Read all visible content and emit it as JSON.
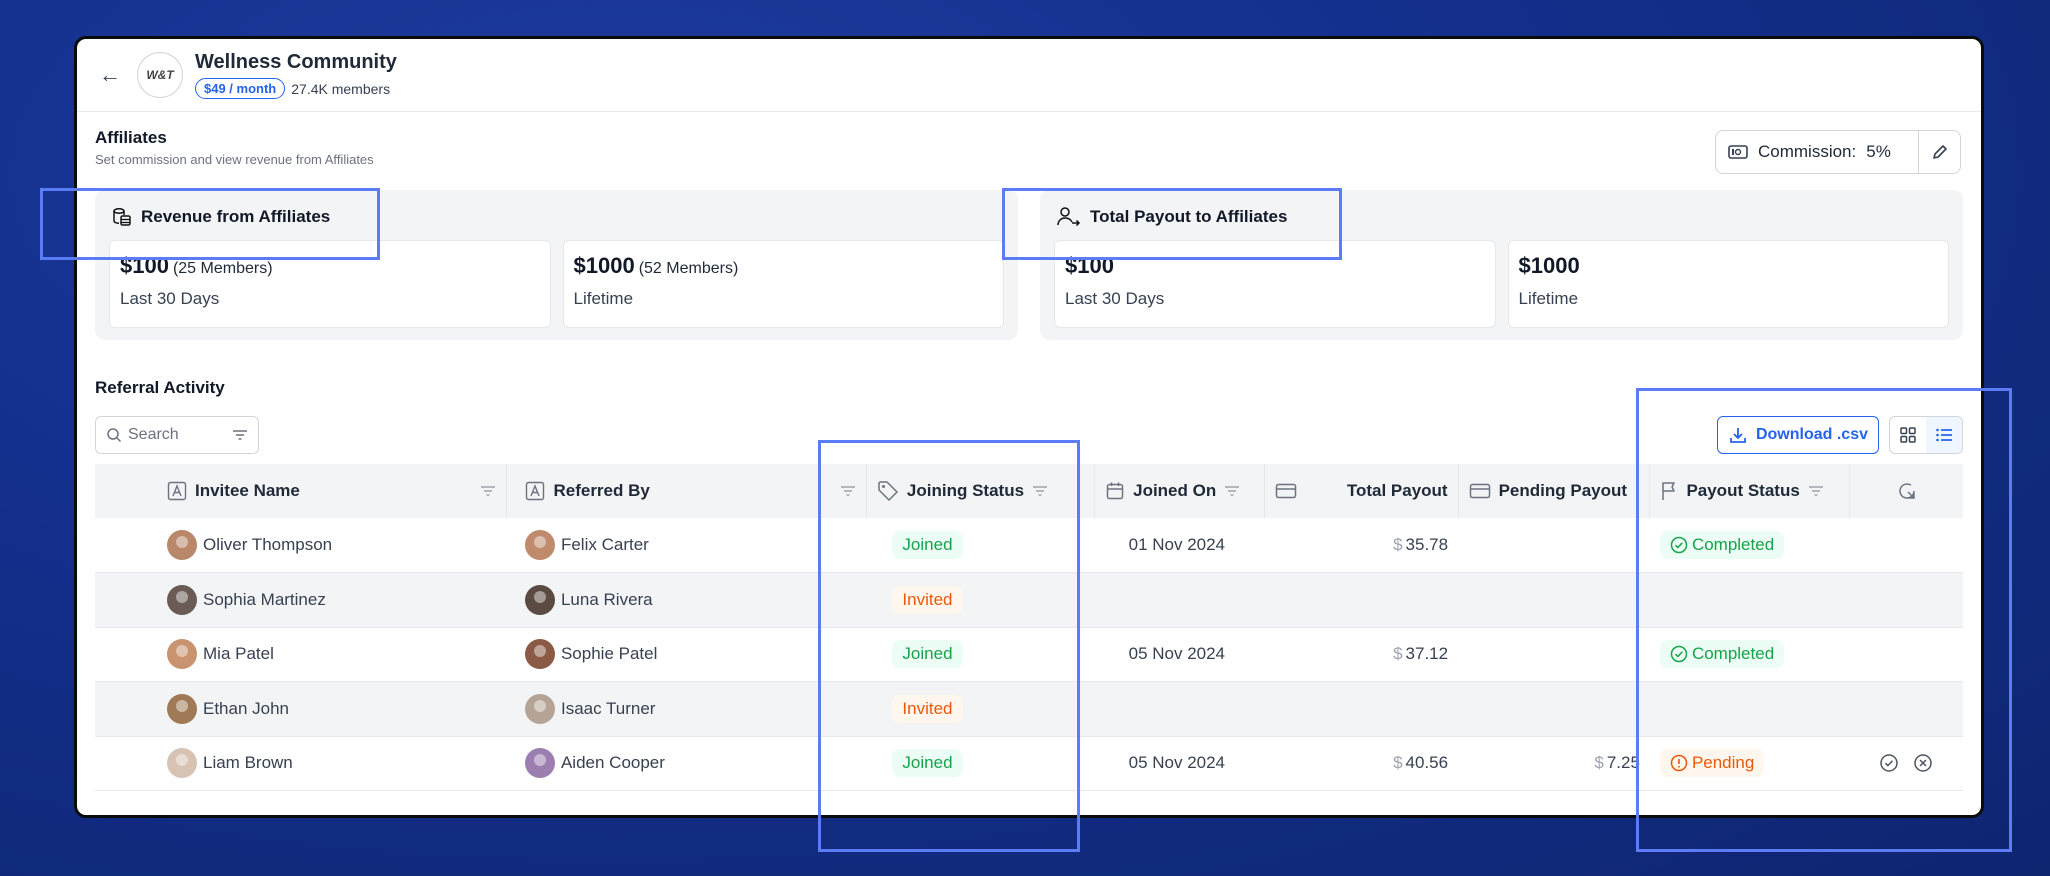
{
  "header": {
    "title": "Wellness Community",
    "price": "$49 / month",
    "members": "27.4K members",
    "logo_text": "W&T"
  },
  "affiliates": {
    "title": "Affiliates",
    "subtitle": "Set commission and view revenue from Affiliates",
    "commission_label": "Commission:",
    "commission_value": "5%"
  },
  "revenue": {
    "title": "Revenue from Affiliates",
    "stats": [
      {
        "value": "$100",
        "members": "(25 Members)",
        "period": "Last 30 Days"
      },
      {
        "value": "$1000",
        "members": "(52 Members)",
        "period": "Lifetime"
      }
    ]
  },
  "payout": {
    "title": "Total Payout to Affiliates",
    "stats": [
      {
        "value": "$100",
        "period": "Last 30 Days"
      },
      {
        "value": "$1000",
        "period": "Lifetime"
      }
    ]
  },
  "referral": {
    "title": "Referral Activity",
    "search_placeholder": "Search",
    "download_label": "Download .csv"
  },
  "table": {
    "columns": [
      "Invitee Name",
      "Referred By",
      "Joining Status",
      "Joined On",
      "Total Payout",
      "Pending Payout",
      "Payout Status"
    ],
    "rows": [
      {
        "invitee": "Oliver Thompson",
        "referrer": "Felix Carter",
        "status": "Joined",
        "joined_on": "01 Nov 2024",
        "currency": "$",
        "total": "35.78",
        "pending": "",
        "payout_status": "Completed"
      },
      {
        "invitee": "Sophia Martinez",
        "referrer": "Luna Rivera",
        "status": "Invited",
        "joined_on": "",
        "currency": "",
        "total": "",
        "pending": "",
        "payout_status": ""
      },
      {
        "invitee": "Mia Patel",
        "referrer": "Sophie Patel",
        "status": "Joined",
        "joined_on": "05 Nov 2024",
        "currency": "$",
        "total": "37.12",
        "pending": "",
        "payout_status": "Completed"
      },
      {
        "invitee": "Ethan John",
        "referrer": "Isaac Turner",
        "status": "Invited",
        "joined_on": "",
        "currency": "",
        "total": "",
        "pending": "",
        "payout_status": ""
      },
      {
        "invitee": "Liam Brown",
        "referrer": "Aiden Cooper",
        "status": "Joined",
        "joined_on": "05 Nov 2024",
        "currency": "$",
        "total": "40.56",
        "pending_currency": "$",
        "pending": "7.25",
        "payout_status": "Pending"
      }
    ]
  },
  "colors": {
    "background": "#14308e",
    "accent": "#2563eb",
    "success": "#16a34a",
    "warning": "#ea580c",
    "highlight": "#5b7cf5"
  }
}
